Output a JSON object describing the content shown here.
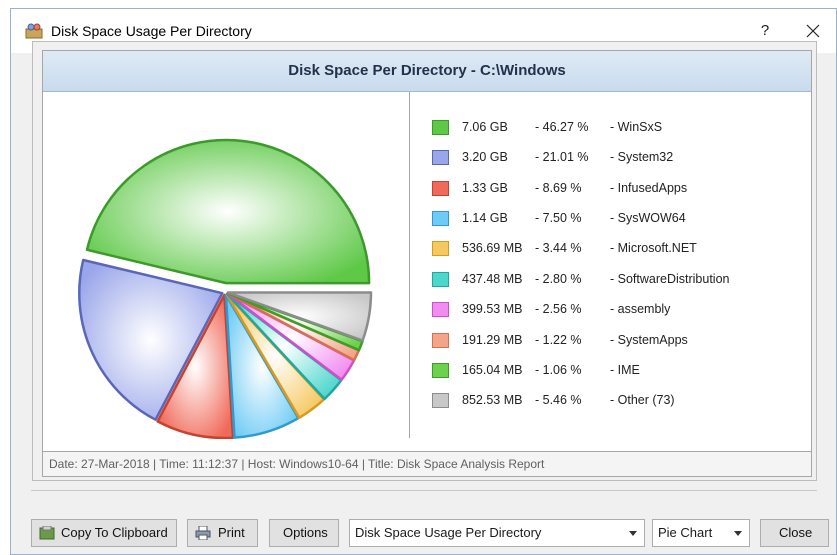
{
  "window": {
    "title": "Disk Space Usage Per Directory",
    "help_label": "?"
  },
  "report": {
    "header": "Disk Space Per Directory - C:\\Windows",
    "footer": "Date: 27-Mar-2018 | Time: 11:12:37 | Host: Windows10-64 | Title: Disk Space Analysis Report"
  },
  "legend": [
    {
      "size": "7.06 GB",
      "pct": "- 46.27 %",
      "name": "- WinSxS",
      "fill": "#5ec847",
      "border": "#3a9a2a"
    },
    {
      "size": "3.20 GB",
      "pct": "- 21.01 %",
      "name": "- System32",
      "fill": "#9aa6ea",
      "border": "#5a66b8"
    },
    {
      "size": "1.33 GB",
      "pct": "- 8.69 %",
      "name": "- InfusedApps",
      "fill": "#f06a5a",
      "border": "#c8402f"
    },
    {
      "size": "1.14 GB",
      "pct": "- 7.50 %",
      "name": "- SysWOW64",
      "fill": "#6ecbf5",
      "border": "#2f9ad0"
    },
    {
      "size": "536.69 MB",
      "pct": "- 3.44 %",
      "name": "- Microsoft.NET",
      "fill": "#f5c860",
      "border": "#d99a20"
    },
    {
      "size": "437.48 MB",
      "pct": "- 2.80 %",
      "name": "- SoftwareDistribution",
      "fill": "#4dd6cc",
      "border": "#1fa89e"
    },
    {
      "size": "399.53 MB",
      "pct": "- 2.56 %",
      "name": "- assembly",
      "fill": "#f28cf0",
      "border": "#cc50c8"
    },
    {
      "size": "191.29 MB",
      "pct": "- 1.22 %",
      "name": "- SystemApps",
      "fill": "#f3a58a",
      "border": "#d57050"
    },
    {
      "size": "165.04 MB",
      "pct": "- 1.06 %",
      "name": "- IME",
      "fill": "#6cd14e",
      "border": "#3c9f24"
    },
    {
      "size": "852.53 MB",
      "pct": "- 5.46 %",
      "name": "- Other (73)",
      "fill": "#c8c8c8",
      "border": "#8c8c8c"
    }
  ],
  "chart_data": {
    "type": "pie",
    "title": "Disk Space Per Directory - C:\\Windows",
    "categories": [
      "WinSxS",
      "System32",
      "InfusedApps",
      "SysWOW64",
      "Microsoft.NET",
      "SoftwareDistribution",
      "assembly",
      "SystemApps",
      "IME",
      "Other (73)"
    ],
    "values": [
      46.27,
      21.01,
      8.69,
      7.5,
      3.44,
      2.8,
      2.56,
      1.22,
      1.06,
      5.46
    ],
    "sizes": [
      "7.06 GB",
      "3.20 GB",
      "1.33 GB",
      "1.14 GB",
      "536.69 MB",
      "437.48 MB",
      "399.53 MB",
      "191.29 MB",
      "165.04 MB",
      "852.53 MB"
    ],
    "legend_position": "right",
    "exploded_slice": "WinSxS"
  },
  "buttons": {
    "copy": "Copy To Clipboard",
    "print": "Print",
    "options": "Options",
    "close": "Close"
  },
  "selects": {
    "report": "Disk Space Usage Per Directory",
    "chart_type": "Pie Chart"
  }
}
